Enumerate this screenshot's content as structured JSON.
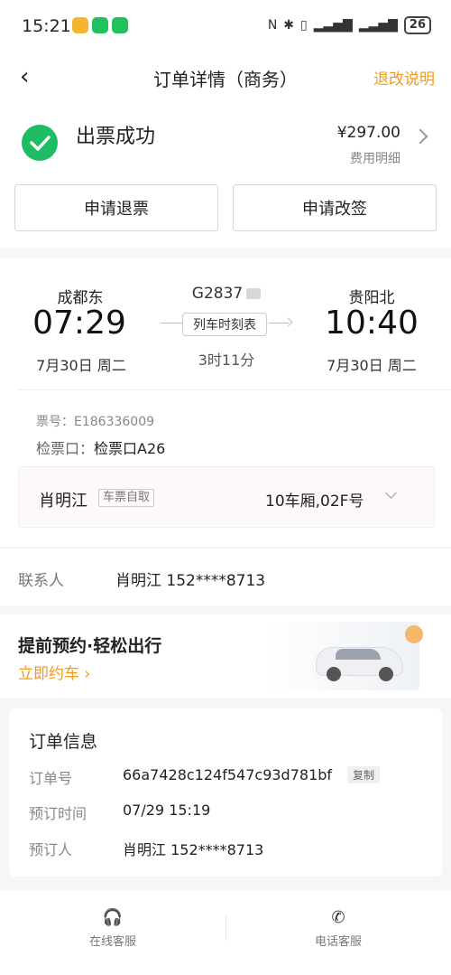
{
  "status_bar": {
    "time": "15:21",
    "battery": "26",
    "app_colors": [
      "#f5b531",
      "#20c35b",
      "#20c35b"
    ]
  },
  "header": {
    "title": "订单详情（商务）",
    "right_link": "退改说明",
    "back_icon": "back-arrow-icon"
  },
  "order_status": {
    "status": "出票成功",
    "price": "¥297.00",
    "price_detail": "费用明细",
    "buttons": {
      "refund": "申请退票",
      "change": "申请改签"
    }
  },
  "train": {
    "from_station": "成都东",
    "depart_time": "07:29",
    "depart_date": "7月30日 周二",
    "train_no": "G2837",
    "timetable": "列车时刻表",
    "duration": "3时11分",
    "to_station": "贵阳北",
    "arrive_time": "10:40",
    "arrive_date": "7月30日 周二",
    "ticket_no": "票号：E186336009",
    "gate_label": "检票口：",
    "gate_value": "检票口A26"
  },
  "passenger": {
    "name": "肖明江",
    "tag": "车票自取",
    "seat": "10车厢,02F号"
  },
  "contact": {
    "label": "联系人",
    "value": "肖明江  152****8713"
  },
  "promo": {
    "title": "提前预约·轻松出行",
    "link": "立即约车 ›"
  },
  "order_info": {
    "title": "订单信息",
    "rows": [
      {
        "label": "订单号",
        "value": "66a7428c124f547c93d781bf"
      },
      {
        "label": "预订时间",
        "value": "07/29 15:19"
      },
      {
        "label": "预订人",
        "value": "肖明江   152****8713"
      }
    ],
    "copy": "复制"
  },
  "bottom_bar": {
    "online_service": "在线客服",
    "phone_service": "电话客服"
  },
  "colors": {
    "accent": "#f39a1c",
    "success": "#1fbc66"
  }
}
